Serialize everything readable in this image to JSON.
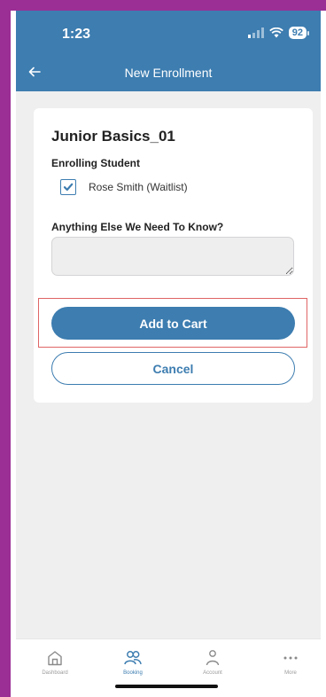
{
  "status_bar": {
    "time": "1:23",
    "battery": "92"
  },
  "header": {
    "title": "New Enrollment"
  },
  "card": {
    "class_title": "Junior Basics_01",
    "enrolling_label": "Enrolling Student",
    "student_name": "Rose Smith  (Waitlist)",
    "student_checked": true,
    "notes_label": "Anything Else We Need To Know?",
    "notes_value": "",
    "add_label": "Add to Cart",
    "cancel_label": "Cancel"
  },
  "tabbar": {
    "items": [
      {
        "label": "Dashboard",
        "icon": "home-icon",
        "active": false
      },
      {
        "label": "Booking",
        "icon": "people-icon",
        "active": true
      },
      {
        "label": "Account",
        "icon": "person-icon",
        "active": false
      },
      {
        "label": "More",
        "icon": "more-icon",
        "active": false
      }
    ]
  },
  "colors": {
    "brand": "#3d7db0",
    "frame": "#9b2f95",
    "highlight": "#e06565"
  }
}
